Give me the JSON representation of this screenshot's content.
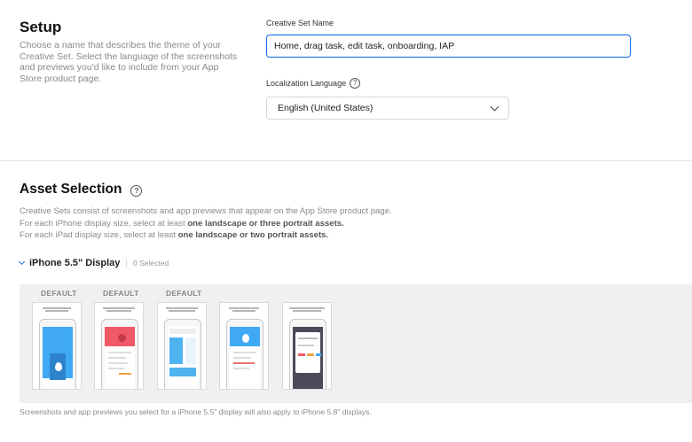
{
  "setup": {
    "title": "Setup",
    "description": "Choose a name that describes the theme of your Creative Set. Select the language of the screenshots and previews you'd like to include from your App Store product page."
  },
  "creative_set": {
    "label": "Creative Set Name",
    "value": "Home, drag task, edit task, onboarding, IAP"
  },
  "localization": {
    "label": "Localization Language",
    "selected": "English (United States)"
  },
  "asset_selection": {
    "title": "Asset Selection",
    "line1": "Creative Sets consist of screenshots and app previews that appear on the App Store product page.",
    "line2_prefix": "For each iPhone display size, select at least ",
    "line2_bold": "one landscape or three portrait assets.",
    "line3_prefix": "For each iPad display size, select at least ",
    "line3_bold": "one landscape or two portrait assets."
  },
  "iphone_section": {
    "title": "iPhone 5.5\" Display",
    "selected_count": "0 Selected",
    "default_labels": [
      "DEFAULT",
      "DEFAULT",
      "DEFAULT"
    ],
    "footnote": "Screenshots and app previews you select for a iPhone 5.5\" display will also apply to iPhone 5.8\" displays."
  },
  "colors": {
    "accent": "#1a73e8",
    "thumb1_screen": "#3fa9f5",
    "thumb2_screen": "#f05a67",
    "thumb3_screen": "#4fb3ef",
    "thumb4_screen": "#3fa9f5",
    "thumb5_screen": "#4a4a5a"
  }
}
